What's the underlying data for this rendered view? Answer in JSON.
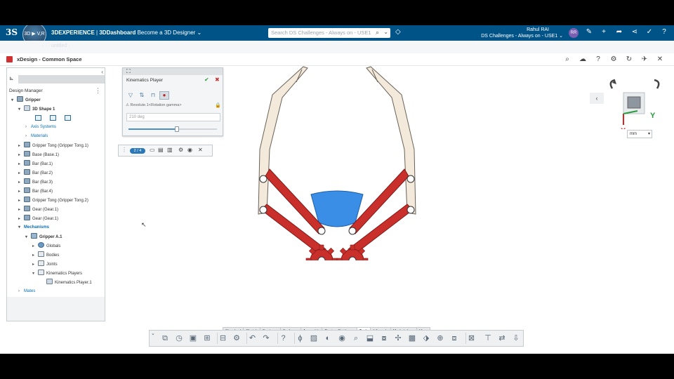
{
  "topbar": {
    "brand": "3S",
    "compass_label": "3D ▶ V,R",
    "platform": "3DEXPERIENCE",
    "separator": "|",
    "app": "3DDashboard",
    "dashboard": "Become a 3D Designer",
    "dashboard_caret": "⌄",
    "search_placeholder": "Search DS Challenges - Always on - USE1",
    "search_icon": "search-icon",
    "user_name": "Rahul RAI",
    "tenant": "DS Challenges - Always on - USE1",
    "tenant_caret": "⌄",
    "avatar_initials": "RR"
  },
  "ghost_row_text": "· · · untitled ·",
  "app_header": {
    "title": "xDesign - Common Space"
  },
  "tree": {
    "header": "Design Manager",
    "nodes": [
      {
        "label": "Gripper"
      },
      {
        "label": "3D Shape 1"
      },
      {
        "label": "Axis Systems"
      },
      {
        "label": "Materials"
      },
      {
        "label": "Gripper Tong (Gripper Tong.1)"
      },
      {
        "label": "Base (Base.1)"
      },
      {
        "label": "Bar (Bar.1)"
      },
      {
        "label": "Bar (Bar.2)"
      },
      {
        "label": "Bar (Bar.3)"
      },
      {
        "label": "Bar (Bar.4)"
      },
      {
        "label": "Gripper Tong (Gripper Tong.2)"
      },
      {
        "label": "Gear (Gear.1)"
      },
      {
        "label": "Gear (Gear.1)"
      },
      {
        "label": "Mechanisms"
      },
      {
        "label": "Gripper A.1"
      },
      {
        "label": "Globals"
      },
      {
        "label": "Bodies"
      },
      {
        "label": "Joints"
      },
      {
        "label": "Kinematics Players"
      },
      {
        "label": "Kinematics Player.1"
      },
      {
        "label": "Mates"
      }
    ],
    "planes": [
      "XY",
      "YZ",
      "ZX"
    ]
  },
  "kinematics_panel": {
    "title": "Kinematics Player",
    "joint": "Revolute.1<Rotation gamma>",
    "angle_value": "210 deg",
    "slider_fraction": 0.55
  },
  "playbar": {
    "step": "2 / 4"
  },
  "viewport": {
    "unit": "mm",
    "axis_y": "Y",
    "axis_x": "X"
  },
  "tabs": [
    "Standard",
    "Sketch",
    "Features",
    "Surfaces",
    "Assembly",
    "Design Guidance",
    "Tools",
    "Lifecycle",
    "Marketplace",
    "View"
  ],
  "active_tab": "Tools",
  "colors": {
    "topbar": "#005386",
    "link": "#0b6fb3",
    "bar_red": "#c9302c",
    "tong_beige": "#f3eadc",
    "base_blue": "#3a8ee6"
  }
}
